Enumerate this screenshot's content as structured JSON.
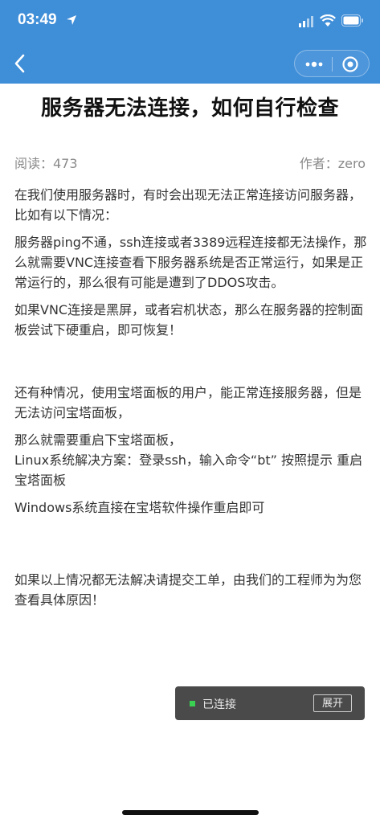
{
  "status_bar": {
    "time": "03:49",
    "icons": [
      "location-arrow-icon",
      "signal-icon",
      "wifi-icon",
      "battery-icon"
    ]
  },
  "nav": {
    "back_icon": "chevron-left-icon",
    "more_icon": "more-dots-icon",
    "close_icon": "target-circle-icon",
    "bar_color": "#3f8ed8"
  },
  "article": {
    "title": "服务器无法连接，如何自行检查",
    "reads": "阅读：473",
    "author": "作者：zero",
    "paragraphs": [
      "在我们使用服务器时，有时会出现无法正常连接访问服务器，比如有以下情况：",
      "服务器ping不通，ssh连接或者3389远程连接都无法操作，那么就需要VNC连接查看下服务器系统是否正常运行，如果是正常运行的，那么很有可能是遭到了DDOS攻击。",
      "如果VNC连接是黑屏，或者宕机状态，那么在服务器的控制面板尝试下硬重启，即可恢复！",
      "还有种情况，使用宝塔面板的用户，能正常连接服务器，但是无法访问宝塔面板，",
      "那么就需要重启下宝塔面板，",
      "Linux系统解决方案：登录ssh，输入命令“bt” 按照提示 重启宝塔面板",
      "Windows系统直接在宝塔软件操作重启即可",
      "如果以上情况都无法解决请提交工单，由我们的工程师为为您查看具体原因！"
    ]
  },
  "floating": {
    "status": "已连接",
    "expand": "展开",
    "status_color": "#3ad052"
  }
}
